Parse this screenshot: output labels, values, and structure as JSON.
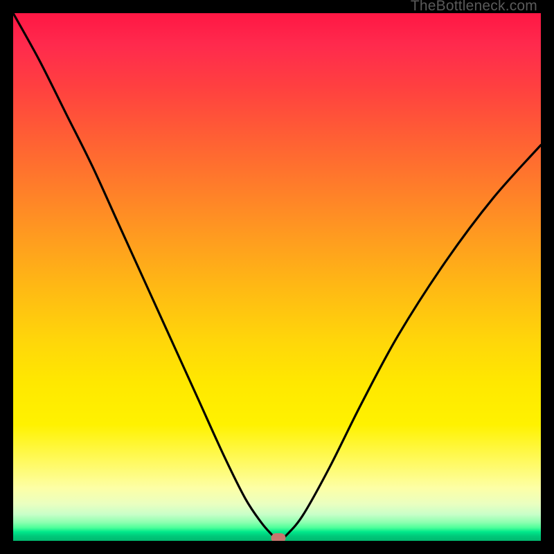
{
  "watermark": "TheBottleneck.com",
  "chart_data": {
    "type": "line",
    "title": "",
    "xlabel": "",
    "ylabel": "",
    "x_range": [
      0,
      100
    ],
    "y_range": [
      0,
      100
    ],
    "minimum_marker": {
      "x": 50.3,
      "y": 0
    },
    "series": [
      {
        "name": "bottleneck-curve",
        "x": [
          0,
          5,
          10,
          15,
          20,
          25,
          30,
          35,
          40,
          44,
          47,
          49,
          50.3,
          52,
          55,
          60,
          66,
          73,
          82,
          91,
          100
        ],
        "y": [
          100,
          91,
          81,
          71,
          60,
          49,
          38,
          27,
          16,
          8,
          3.5,
          1.2,
          0,
          1.3,
          5,
          14,
          26,
          39,
          53,
          65,
          75
        ]
      }
    ],
    "background_gradient": {
      "top_color": "#ff1744",
      "mid_color": "#ffe800",
      "bottom_color": "#00b86f"
    },
    "accent": {
      "marker_color": "#c6766e",
      "curve_color": "#000000"
    }
  }
}
